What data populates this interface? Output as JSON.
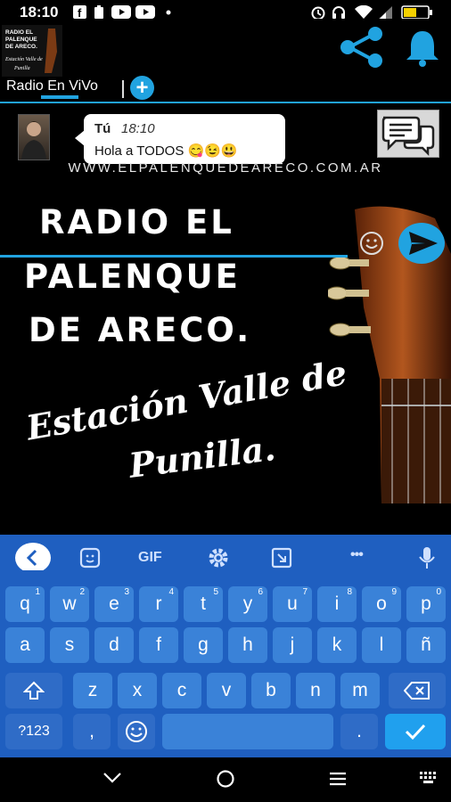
{
  "status": {
    "time": "18:10",
    "icons": [
      "facebook-icon",
      "battery-saver-icon",
      "youtube-icon",
      "youtube-icon",
      "dot-icon",
      "alarm-icon",
      "headset-icon",
      "wifi-icon",
      "signal-icon",
      "battery-icon"
    ]
  },
  "app": {
    "logo_lines": [
      "RADIO EL",
      "PALENQUE",
      "DE ARECO.",
      "Estación Valle de",
      "Punilla"
    ],
    "accent": "#21a3e0"
  },
  "tabs": {
    "radio_label": "Radio En ViVo",
    "add_label": "+"
  },
  "chat": {
    "author": "Tú",
    "time": "18:10",
    "text": "Hola a TODOS 😋😉😃"
  },
  "banner": {
    "url": "WWW.ELPALENQUEDEARECO.COM.AR",
    "title_lines": [
      "RADIO EL",
      "PALENQUE",
      "DE ARECO."
    ],
    "subtitle_lines": [
      "Estación Valle de",
      "Punilla."
    ]
  },
  "keyboard": {
    "toolbar": [
      "back-icon",
      "sticker-icon",
      "GIF",
      "settings-icon",
      "clipboard-icon",
      "more-icon",
      "mic-icon"
    ],
    "gif_label": "GIF",
    "more_label": "•••",
    "row1": [
      {
        "k": "q",
        "s": "1"
      },
      {
        "k": "w",
        "s": "2"
      },
      {
        "k": "e",
        "s": "3"
      },
      {
        "k": "r",
        "s": "4"
      },
      {
        "k": "t",
        "s": "5"
      },
      {
        "k": "y",
        "s": "6"
      },
      {
        "k": "u",
        "s": "7"
      },
      {
        "k": "i",
        "s": "8"
      },
      {
        "k": "o",
        "s": "9"
      },
      {
        "k": "p",
        "s": "0"
      }
    ],
    "row2": [
      "a",
      "s",
      "d",
      "f",
      "g",
      "h",
      "j",
      "k",
      "l",
      "ñ"
    ],
    "row3": [
      "z",
      "x",
      "c",
      "v",
      "b",
      "n",
      "m"
    ],
    "sym_label": "?123",
    "comma": ",",
    "period": "."
  }
}
